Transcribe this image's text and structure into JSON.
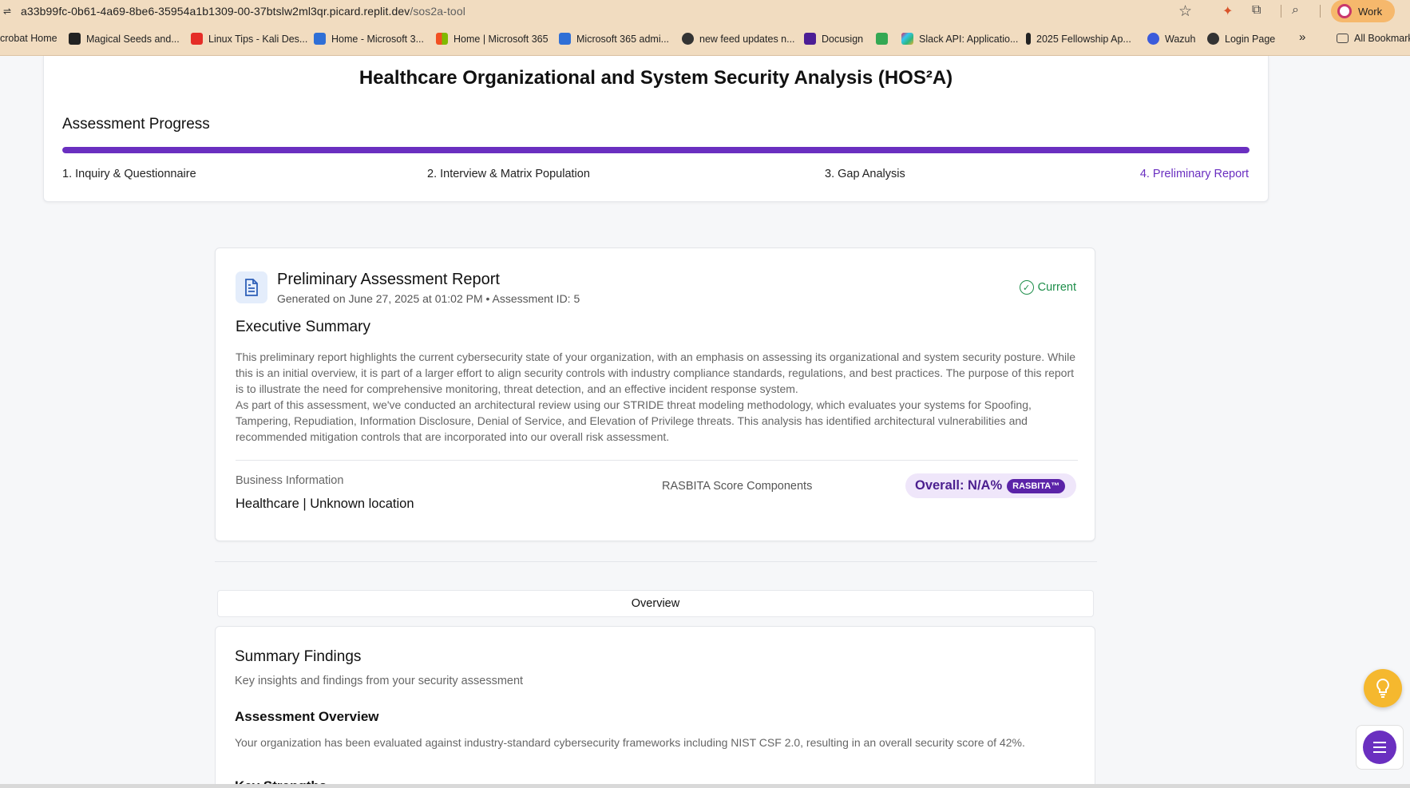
{
  "browser": {
    "url_host": "a33b99fc-0b61-4a69-8be6-35954a1b1309-00-37btslw2ml3qr.picard.replit.dev",
    "url_path": "/sos2a-tool",
    "profile_label": "Work",
    "bookmarks": [
      {
        "label": "crobat Home",
        "icon": "acrobat-icon"
      },
      {
        "label": "Magical Seeds and...",
        "icon": "seeds-icon"
      },
      {
        "label": "Linux Tips - Kali Des...",
        "icon": "youtube-icon"
      },
      {
        "label": "Home - Microsoft 3...",
        "icon": "azure-icon"
      },
      {
        "label": "Home | Microsoft 365",
        "icon": "microsoft-icon"
      },
      {
        "label": "Microsoft 365 admi...",
        "icon": "azure-icon"
      },
      {
        "label": "new feed updates n...",
        "icon": "globe-icon"
      },
      {
        "label": "Docusign",
        "icon": "docusign-icon"
      },
      {
        "label": "",
        "icon": "meet-icon"
      },
      {
        "label": "Slack API: Applicatio...",
        "icon": "slack-icon"
      },
      {
        "label": "2025 Fellowship Ap...",
        "icon": "fellowship-icon"
      },
      {
        "label": "Wazuh",
        "icon": "wazuh-icon"
      },
      {
        "label": "Login Page",
        "icon": "globe-icon"
      }
    ],
    "more_label": "»",
    "all_bookmarks_label": "All Bookmark"
  },
  "header": {
    "title": "Healthcare Organizational and System Security Analysis (HOS²A)",
    "progress_label": "Assessment Progress",
    "progress_fraction": 1.0,
    "steps": [
      "1. Inquiry & Questionnaire",
      "2. Interview & Matrix Population",
      "3. Gap Analysis",
      "4. Preliminary Report"
    ],
    "active_step_index": 3
  },
  "report": {
    "title": "Preliminary Assessment Report",
    "meta": "Generated on June 27, 2025 at 01:02 PM • Assessment ID: 5",
    "status": "Current",
    "exec_title": "Executive Summary",
    "para1": "This preliminary report highlights the current cybersecurity state of your organization, with an emphasis on assessing its organizational and system security posture. While this is an initial overview, it is part of a larger effort to align security controls with industry compliance standards, regulations, and best practices. The purpose of this report is to illustrate the need for comprehensive monitoring, threat detection, and an effective incident response system.",
    "para2": "As part of this assessment, we've conducted an architectural review using our STRIDE threat modeling methodology, which evaluates your systems for Spoofing, Tampering, Repudiation, Information Disclosure, Denial of Service, and Elevation of Privilege threats. This analysis has identified architectural vulnerabilities and recommended mitigation controls that are incorporated into our overall risk assessment.",
    "business_label": "Business Information",
    "business_value": "Healthcare | Unknown location",
    "rasbita_label": "RASBITA Score Components",
    "overall_label": "Overall: N/A%",
    "rasbita_pill": "RASBITA™"
  },
  "tabs": {
    "overview": "Overview"
  },
  "findings": {
    "title": "Summary Findings",
    "subtitle": "Key insights and findings from your security assessment",
    "overview_title": "Assessment Overview",
    "overview_text": "Your organization has been evaluated against industry-standard cybersecurity frameworks including NIST CSF 2.0, resulting in an overall security score of 42%.",
    "next_heading": "Key Strengths"
  },
  "colors": {
    "accent": "#6a2fc0",
    "success": "#1e8e4a",
    "fab_bulb": "#f5b82e"
  }
}
